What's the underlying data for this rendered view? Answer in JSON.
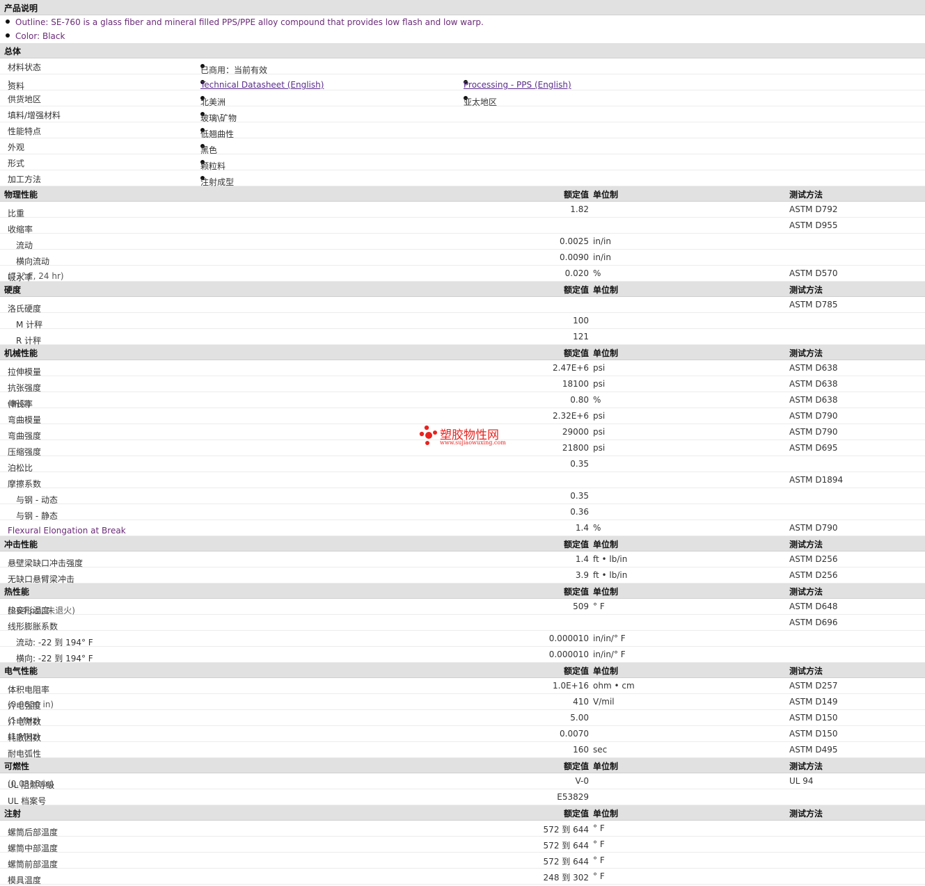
{
  "product_description": {
    "title": "产品说明",
    "items": [
      "Outline: SE-760 is a glass fiber and mineral filled PPS/PPE alloy compound that provides low flash and low warp.",
      "Color: Black"
    ]
  },
  "general": {
    "title": "总体",
    "material_status": {
      "label": "材料状态",
      "value": "已商用：当前有效"
    },
    "documents": {
      "label": "资料",
      "sup": "1",
      "links": [
        "Technical Datasheet (English)",
        "Processing - PPS (English)"
      ]
    },
    "availability": {
      "label": "供货地区",
      "values": [
        "北美洲",
        "亚太地区"
      ]
    },
    "filler": {
      "label": "填料/增强材料",
      "value": "玻璃\\矿物"
    },
    "features": {
      "label": "性能特点",
      "value": "低翘曲性"
    },
    "appearance": {
      "label": "外观",
      "value": "黑色"
    },
    "form": {
      "label": "形式",
      "value": "颗粒料"
    },
    "processing": {
      "label": "加工方法",
      "value": "注射成型"
    }
  },
  "headers": {
    "nominal": "额定值",
    "unit": "单位制",
    "test": "测试方法"
  },
  "physical": {
    "title": "物理性能",
    "rows": [
      {
        "label": "比重",
        "value": "1.82",
        "unit": "",
        "test": "ASTM D792"
      },
      {
        "label": "收缩率",
        "value": "",
        "unit": "",
        "test": "ASTM D955"
      },
      {
        "label": "流动",
        "value": "0.0025",
        "unit": "in/in",
        "test": ""
      },
      {
        "label": "横向流动",
        "value": "0.0090",
        "unit": "in/in",
        "test": ""
      },
      {
        "label": "吸水率",
        "cond": "(73° F, 24 hr)",
        "value": "0.020",
        "unit": "%",
        "test": "ASTM D570"
      }
    ]
  },
  "hardness": {
    "title": "硬度",
    "rows": [
      {
        "label": "洛氏硬度",
        "value": "",
        "unit": "",
        "test": "ASTM D785"
      },
      {
        "label": "M 计秤",
        "value": "100",
        "unit": "",
        "test": ""
      },
      {
        "label": "R 计秤",
        "value": "121",
        "unit": "",
        "test": ""
      }
    ]
  },
  "mechanical": {
    "title": "机械性能",
    "rows": [
      {
        "label": "拉伸模量",
        "value": "2.47E+6",
        "unit": "psi",
        "test": "ASTM D638"
      },
      {
        "label": "抗张强度",
        "value": "18100",
        "unit": "psi",
        "test": "ASTM D638"
      },
      {
        "label": "伸长率",
        "cond": "(断裂)",
        "value": "0.80",
        "unit": "%",
        "test": "ASTM D638"
      },
      {
        "label": "弯曲模量",
        "value": "2.32E+6",
        "unit": "psi",
        "test": "ASTM D790"
      },
      {
        "label": "弯曲强度",
        "value": "29000",
        "unit": "psi",
        "test": "ASTM D790"
      },
      {
        "label": "压缩强度",
        "value": "21800",
        "unit": "psi",
        "test": "ASTM D695"
      },
      {
        "label": "泊松比",
        "value": "0.35",
        "unit": "",
        "test": ""
      },
      {
        "label": "摩擦系数",
        "value": "",
        "unit": "",
        "test": "ASTM D1894"
      },
      {
        "label": "与钢 - 动态",
        "value": "0.35",
        "unit": "",
        "test": ""
      },
      {
        "label": "与钢 - 静态",
        "value": "0.36",
        "unit": "",
        "test": ""
      },
      {
        "label": "Flexural Elongation at Break",
        "value": "1.4",
        "unit": "%",
        "test": "ASTM D790"
      }
    ]
  },
  "impact": {
    "title": "冲击性能",
    "rows": [
      {
        "label": "悬壁梁缺口冲击强度",
        "value": "1.4",
        "unit": "ft • lb/in",
        "test": "ASTM D256"
      },
      {
        "label": "无缺口悬臂梁冲击",
        "value": "3.9",
        "unit": "ft • lb/in",
        "test": "ASTM D256"
      }
    ]
  },
  "thermal": {
    "title": "热性能",
    "rows": [
      {
        "label": "热变形温度",
        "cond": "(264 psi, 未退火)",
        "value": "509",
        "unit": "° F",
        "test": "ASTM D648"
      },
      {
        "label": "线形膨胀系数",
        "value": "",
        "unit": "",
        "test": "ASTM D696"
      },
      {
        "label": "流动: -22 到 194° F",
        "value": "0.000010",
        "unit": "in/in/° F",
        "test": ""
      },
      {
        "label": "横向: -22 到 194° F",
        "value": "0.000010",
        "unit": "in/in/° F",
        "test": ""
      }
    ]
  },
  "electrical": {
    "title": "电气性能",
    "rows": [
      {
        "label": "体积电阻率",
        "value": "1.0E+16",
        "unit": "ohm • cm",
        "test": "ASTM D257"
      },
      {
        "label": "介电强度",
        "cond": "(0.0630 in)",
        "value": "410",
        "unit": "V/mil",
        "test": "ASTM D149"
      },
      {
        "label": "介电常数",
        "cond": "(1 MHz)",
        "value": "5.00",
        "unit": "",
        "test": "ASTM D150"
      },
      {
        "label": "耗散因数",
        "cond": "(1 MHz)",
        "value": "0.0070",
        "unit": "",
        "test": "ASTM D150"
      },
      {
        "label": "耐电弧性",
        "value": "160",
        "unit": "sec",
        "test": "ASTM D495"
      }
    ]
  },
  "flammability": {
    "title": "可燃性",
    "rows": [
      {
        "label": "UL 阻燃等级",
        "cond": "(0.0315 in)",
        "value": "V-0",
        "unit": "",
        "test": "UL 94"
      },
      {
        "label": "UL 档案号",
        "value": "E53829",
        "unit": "",
        "test": ""
      }
    ]
  },
  "injection": {
    "title": "注射",
    "rows": [
      {
        "label": "螺筒后部温度",
        "value": "572 到 644",
        "unit": "° F",
        "test": ""
      },
      {
        "label": "螺筒中部温度",
        "value": "572 到 644",
        "unit": "° F",
        "test": ""
      },
      {
        "label": "螺筒前部温度",
        "value": "572 到 644",
        "unit": "° F",
        "test": ""
      },
      {
        "label": "模具温度",
        "value": "248 到 302",
        "unit": "° F",
        "test": ""
      }
    ]
  },
  "watermark": {
    "name": "塑胶物性网",
    "url": "www.sujiaowuxing.com"
  }
}
